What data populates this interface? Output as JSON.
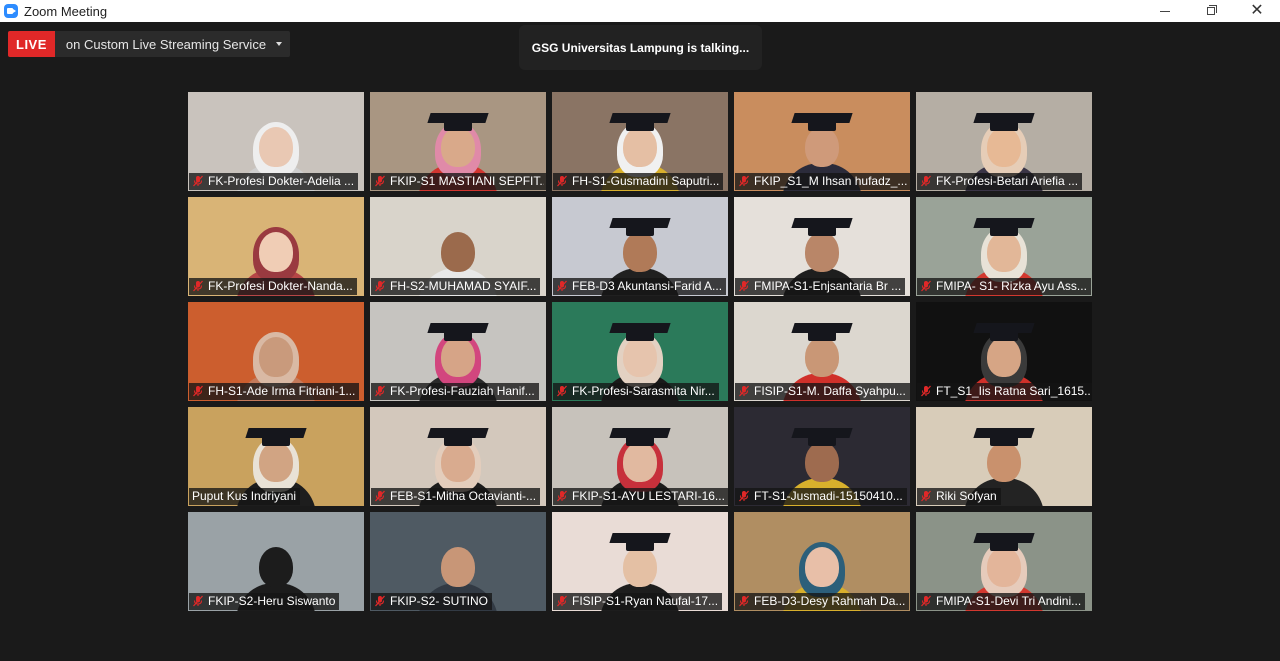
{
  "window": {
    "title": "Zoom Meeting",
    "controls": {
      "minimize": "minimize",
      "restore": "restore",
      "close": "close"
    }
  },
  "live": {
    "badge": "LIVE",
    "service": "on Custom Live Streaming Service"
  },
  "speaker_notice": "GSG Universitas Lampung is talking...",
  "participants": [
    {
      "name": "FK-Profesi Dokter-Adelia ...",
      "muted": true,
      "bg": "#c9c3bd",
      "skin": "#e9c8b3",
      "hijab": "#eeeeee",
      "cap": false,
      "body": "#cfcfcf"
    },
    {
      "name": "FKIP-S1 MASTIANI SEPFIT...",
      "muted": true,
      "bg": "#a99682",
      "skin": "#d9a98a",
      "hijab": "#e08aa8",
      "cap": true,
      "body": "#d2352f"
    },
    {
      "name": "FH-S1-Gusmadini Saputri...",
      "muted": true,
      "bg": "#8a7464",
      "skin": "#e5bfa4",
      "hijab": "#f0f0f0",
      "cap": true,
      "body": "#d8b02c"
    },
    {
      "name": "FKIP_S1_M Ihsan hufadz_...",
      "muted": true,
      "bg": "#c98d5e",
      "skin": "#cf9a7a",
      "hijab": "",
      "cap": true,
      "body": "#2b2b3a"
    },
    {
      "name": "FK-Profesi-Betari Ariefia ...",
      "muted": true,
      "bg": "#b5aea4",
      "skin": "#e7b995",
      "hijab": "#e6cdb7",
      "cap": true,
      "body": "#3a3446"
    },
    {
      "name": "FK-Profesi Dokter-Nanda...",
      "muted": true,
      "bg": "#d9b476",
      "skin": "#f0cdb5",
      "hijab": "#9a3a40",
      "cap": false,
      "body": "#b64646"
    },
    {
      "name": "FH-S2-MUHAMAD SYAIF...",
      "muted": true,
      "bg": "#d9d4cb",
      "skin": "#9b6a4c",
      "hijab": "",
      "cap": false,
      "body": "#e8e8e8"
    },
    {
      "name": "FEB-D3 Akuntansi-Farid A...",
      "muted": true,
      "bg": "#c7c9d1",
      "skin": "#b07a58",
      "hijab": "",
      "cap": true,
      "body": "#202020"
    },
    {
      "name": "FMIPA-S1-Enjsantaria Br ...",
      "muted": true,
      "bg": "#e5e0da",
      "skin": "#b98668",
      "hijab": "",
      "cap": true,
      "body": "#1e1e1e"
    },
    {
      "name": "FMIPA- S1- Rizka Ayu Ass...",
      "muted": true,
      "bg": "#9aa398",
      "skin": "#e2b798",
      "hijab": "#e8e2d7",
      "cap": true,
      "body": "#d3382f"
    },
    {
      "name": "FH-S1-Ade Irma Fitriani-1...",
      "muted": true,
      "bg": "#cc5e2e",
      "skin": "#c99a7c",
      "hijab": "#d9b9a4",
      "cap": false,
      "body": "#c47a5a"
    },
    {
      "name": "FK-Profesi-Fauziah Hanif...",
      "muted": true,
      "bg": "#c6c4c0",
      "skin": "#d6a487",
      "hijab": "#d2467e",
      "cap": true,
      "body": "#2a2a2a"
    },
    {
      "name": "FK-Profesi-Sarasmita Nir...",
      "muted": true,
      "bg": "#2b7a5a",
      "skin": "#e6c4ad",
      "hijab": "#e3d1c2",
      "cap": true,
      "body": "#1a1a1a"
    },
    {
      "name": "FISIP-S1-M. Daffa Syahpu...",
      "muted": true,
      "bg": "#dcd7cf",
      "skin": "#c99776",
      "hijab": "",
      "cap": true,
      "body": "#d0302a"
    },
    {
      "name": "FT_S1_Iis Ratna Sari_1615...",
      "muted": true,
      "bg": "#111111",
      "skin": "#d6a585",
      "hijab": "#3a3a3a",
      "cap": true,
      "body": "#d0302a"
    },
    {
      "name": "Puput Kus Indriyani",
      "muted": false,
      "bg": "#c9a25e",
      "skin": "#d1a483",
      "hijab": "#e9e2d6",
      "cap": true,
      "body": "#1d1d1d"
    },
    {
      "name": "FEB-S1-Mitha Octavianti-...",
      "muted": true,
      "bg": "#d3c8bc",
      "skin": "#d9ab8f",
      "hijab": "#e3cdbc",
      "cap": true,
      "body": "#1c1c1c"
    },
    {
      "name": "FKIP-S1-AYU LESTARI-16...",
      "muted": true,
      "bg": "#c7c2bb",
      "skin": "#e1b9a0",
      "hijab": "#c7303b",
      "cap": true,
      "body": "#1d1d1d"
    },
    {
      "name": "FT-S1-Jusmadi-15150410...",
      "muted": true,
      "bg": "#2c2a33",
      "skin": "#9e6b4f",
      "hijab": "",
      "cap": true,
      "body": "#d8b02c"
    },
    {
      "name": "Riki Sofyan",
      "muted": true,
      "bg": "#d8ccb9",
      "skin": "#c9916d",
      "hijab": "",
      "cap": true,
      "body": "#232323"
    },
    {
      "name": "FKIP-S2-Heru Siswanto",
      "muted": true,
      "bg": "#9aa2a6",
      "skin": "#1c1c1c",
      "hijab": "",
      "cap": false,
      "body": "#1c1c1c"
    },
    {
      "name": "FKIP-S2- SUTINO",
      "muted": true,
      "bg": "#4f5a63",
      "skin": "#c89677",
      "hijab": "",
      "cap": false,
      "body": "#323a44"
    },
    {
      "name": "FISIP-S1-Ryan Naufal-17...",
      "muted": true,
      "bg": "#e9dcd6",
      "skin": "#e4c0a4",
      "hijab": "",
      "cap": true,
      "body": "#1d1d1d"
    },
    {
      "name": "FEB-D3-Desy Rahmah Da...",
      "muted": true,
      "bg": "#b08e62",
      "skin": "#e8bfa8",
      "hijab": "#2c5f7a",
      "cap": false,
      "body": "#d8b02c"
    },
    {
      "name": "FMIPA-S1-Devi Tri Andini...",
      "muted": true,
      "bg": "#8b9388",
      "skin": "#e3b59a",
      "hijab": "#e6cbbb",
      "cap": true,
      "body": "#d3382f"
    }
  ]
}
